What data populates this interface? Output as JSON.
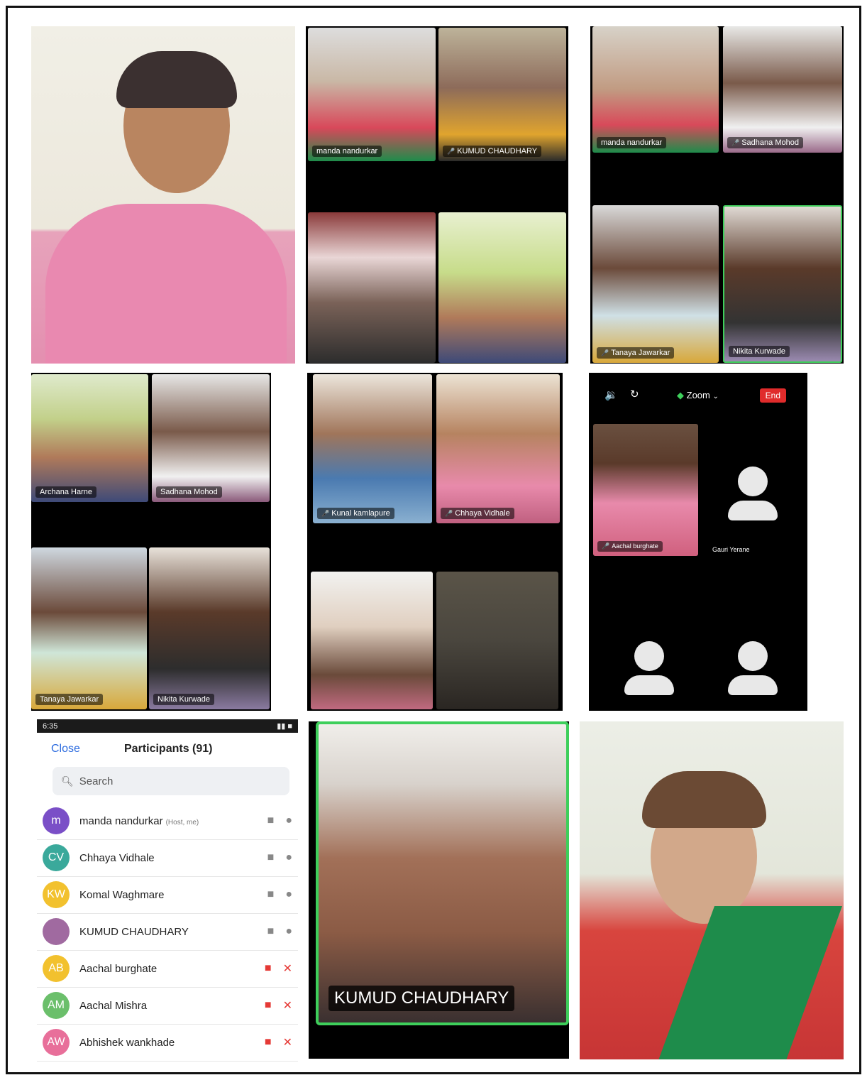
{
  "panel1": {
    "label": ""
  },
  "panel2": {
    "tiles": [
      {
        "name": "manda nandurkar"
      },
      {
        "name": "KUMUD CHAUDHARY"
      }
    ]
  },
  "panel3": {
    "tiles": [
      {
        "name": "manda nandurkar"
      },
      {
        "name": "Sadhana Mohod"
      },
      {
        "name": "Tanaya Jawarkar"
      },
      {
        "name": "Nikita Kurwade"
      }
    ]
  },
  "panel4": {
    "tiles": [
      {
        "name": "Archana Harne"
      },
      {
        "name": "Sadhana Mohod"
      },
      {
        "name": "Tanaya Jawarkar"
      },
      {
        "name": "Nikita Kurwade"
      }
    ]
  },
  "panel5": {
    "tiles": [
      {
        "name": "Kunal kamlapure"
      },
      {
        "name": "Chhaya Vidhale"
      }
    ]
  },
  "panel6": {
    "zoom_label": "Zoom",
    "end_label": "End",
    "tiles": [
      {
        "name": "Aachal burghate"
      },
      {
        "name": "Gauri Yerane"
      }
    ]
  },
  "participants": {
    "status_time": "6:35",
    "close_label": "Close",
    "title": "Participants (91)",
    "search_placeholder": "Search",
    "rows": [
      {
        "initials": "m",
        "name": "manda nandurkar",
        "tag": "(Host, me)",
        "color": "#7a4fc7",
        "muted": false
      },
      {
        "initials": "CV",
        "name": "Chhaya Vidhale",
        "tag": "",
        "color": "#3aa99b",
        "muted": false
      },
      {
        "initials": "KW",
        "name": "Komal Waghmare",
        "tag": "",
        "color": "#f2c12e",
        "muted": false
      },
      {
        "initials": "",
        "name": "KUMUD CHAUDHARY",
        "tag": "",
        "color": "#a06aa0",
        "muted": false
      },
      {
        "initials": "AB",
        "name": "Aachal burghate",
        "tag": "",
        "color": "#f2c12e",
        "muted": true
      },
      {
        "initials": "AM",
        "name": "Aachal Mishra",
        "tag": "",
        "color": "#6bbf6b",
        "muted": true
      },
      {
        "initials": "AW",
        "name": "Abhishek wankhade",
        "tag": "",
        "color": "#e86f9a",
        "muted": true
      }
    ]
  },
  "panel8": {
    "name": "KUMUD CHAUDHARY"
  },
  "colors": {
    "accent": "#2d6cdf",
    "zoom_green": "#3ecf5b",
    "end_red": "#e02b2b",
    "muted_red": "#e53935"
  }
}
